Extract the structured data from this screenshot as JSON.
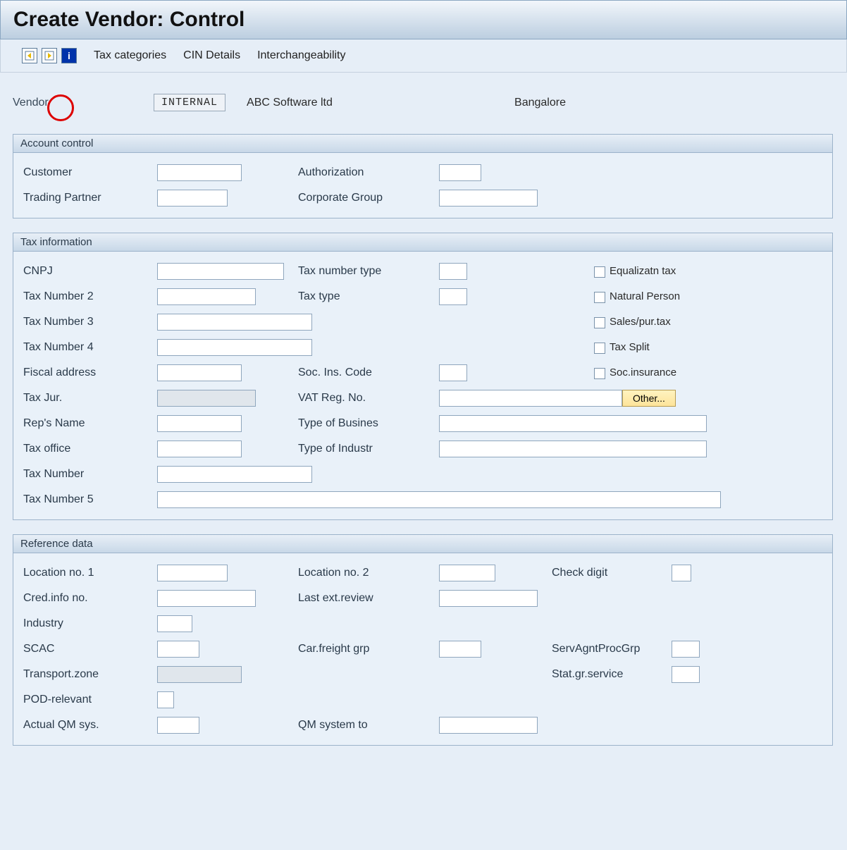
{
  "title": "Create Vendor: Control",
  "toolbar": {
    "tax_categories": "Tax categories",
    "cin_details": "CIN Details",
    "interchangeability": "Interchangeability"
  },
  "vendor": {
    "label": "Vendor",
    "code": "INTERNAL",
    "name": "ABC Software ltd",
    "city": "Bangalore"
  },
  "account_control": {
    "title": "Account control",
    "customer": "Customer",
    "authorization": "Authorization",
    "trading_partner": "Trading Partner",
    "corporate_group": "Corporate Group"
  },
  "tax_info": {
    "title": "Tax information",
    "cnpj": "CNPJ",
    "tax_number_type": "Tax number type",
    "equalizatn_tax": "Equalizatn tax",
    "tax_number_2": "Tax Number 2",
    "tax_type": "Tax type",
    "natural_person": "Natural Person",
    "tax_number_3": "Tax Number 3",
    "sales_pur_tax": "Sales/pur.tax",
    "tax_number_4": "Tax Number 4",
    "tax_split": "Tax Split",
    "fiscal_address": "Fiscal address",
    "soc_ins_code": "Soc. Ins. Code",
    "soc_insurance": "Soc.insurance",
    "tax_jur": "Tax Jur.",
    "vat_reg_no": "VAT Reg. No.",
    "other_btn": "Other...",
    "reps_name": "Rep's Name",
    "type_of_busines": "Type of Busines",
    "tax_office": "Tax office",
    "type_of_industr": "Type of Industr",
    "tax_number": "Tax Number",
    "tax_number_5": "Tax Number 5"
  },
  "reference_data": {
    "title": "Reference data",
    "location_no_1": "Location no. 1",
    "location_no_2": "Location no. 2",
    "check_digit": "Check digit",
    "cred_info_no": "Cred.info no.",
    "last_ext_review": "Last ext.review",
    "industry": "Industry",
    "scac": "SCAC",
    "car_freight_grp": "Car.freight grp",
    "serv_agnt_proc_grp": "ServAgntProcGrp",
    "transport_zone": "Transport.zone",
    "stat_gr_service": "Stat.gr.service",
    "pod_relevant": "POD-relevant",
    "actual_qm_sys": "Actual QM sys.",
    "qm_system_to": "QM system to"
  }
}
